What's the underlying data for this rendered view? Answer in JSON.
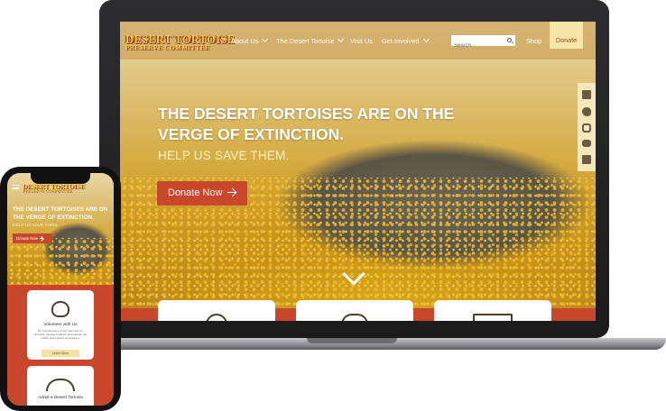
{
  "colors": {
    "accent_red": "#c9482c",
    "logo_gold": "#f5d24a",
    "donate_bg": "#f6e6a8",
    "social_bg": "#f4e7bb"
  },
  "laptop": {
    "logo_line1": "DESERT TORTOISE",
    "logo_line2": "PRESERVE COMMITTEE",
    "nav": [
      {
        "label": "About Us",
        "dropdown": true
      },
      {
        "label": "The Desert Tortoise",
        "dropdown": true
      },
      {
        "label": "Visit Us",
        "dropdown": false
      },
      {
        "label": "Get Involved",
        "dropdown": true
      }
    ],
    "search_placeholder": "Search",
    "shop_label": "Shop",
    "donate_label": "Donate",
    "social_icons": [
      "facebook-icon",
      "twitter-icon",
      "instagram-icon",
      "youtube-icon",
      "linkedin-icon"
    ],
    "hero": {
      "headline": "THE DESERT TORTOISES ARE ON THE VERGE OF EXTINCTION.",
      "subhead": "HELP US SAVE THEM.",
      "cta_label": "Donate Now"
    },
    "scroll_icon": "chevron-down-icon",
    "card_icons": [
      "heart-hand-icon",
      "tortoise-icon",
      "sign-icon"
    ]
  },
  "phone": {
    "logo_line1": "DESERT TORTOISE",
    "logo_line2": "PRESERVE COMMITTEE",
    "hero": {
      "headline": "THE DESERT TORTOISES ARE ON THE VERGE OF EXTINCTION.",
      "subhead": "HELP US SAVE THEM.",
      "cta_label": "Donate Now"
    },
    "cards": [
      {
        "title": "Volunteer with Us",
        "text": "By volunteering you can help care for tortoises, manage habitats, and educate the public about desert ecosystems.",
        "button": "Learn More"
      },
      {
        "title": "Adopt a Desert Tortoise"
      }
    ]
  }
}
